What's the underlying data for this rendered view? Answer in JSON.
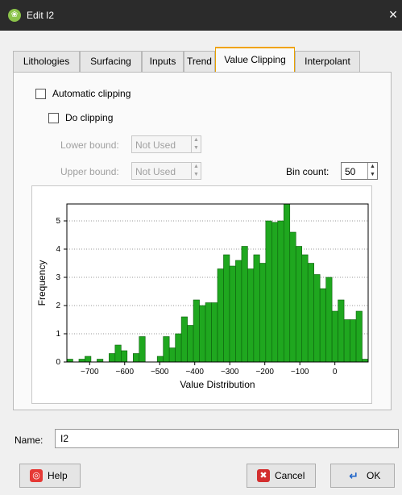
{
  "window": {
    "title": "Edit I2",
    "close_glyph": "×",
    "app_icon": "app-logo-icon"
  },
  "tabs": [
    {
      "label": "Lithologies",
      "active": false
    },
    {
      "label": "Surfacing",
      "active": false
    },
    {
      "label": "Inputs",
      "active": false
    },
    {
      "label": "Trend",
      "active": false
    },
    {
      "label": "Value Clipping",
      "active": true
    },
    {
      "label": "Interpolant",
      "active": false
    }
  ],
  "clipping": {
    "automatic_label": "Automatic clipping",
    "automatic_checked": false,
    "do_clipping_label": "Do clipping",
    "do_clipping_checked": false,
    "lower_bound_label": "Lower bound:",
    "lower_bound_value": "Not Used",
    "upper_bound_label": "Upper bound:",
    "upper_bound_value": "Not Used",
    "bin_count_label": "Bin count:",
    "bin_count_value": "50"
  },
  "chart_data": {
    "type": "bar",
    "xlabel": "Value Distribution",
    "ylabel": "Frequency",
    "xlim": [
      -765,
      95
    ],
    "ylim": [
      0,
      5.6
    ],
    "xticks": [
      -700,
      -600,
      -500,
      -400,
      -300,
      -200,
      -100,
      0
    ],
    "xtick_labels": [
      "−700",
      "−600",
      "−500",
      "−400",
      "−300",
      "−200",
      "−100",
      "0"
    ],
    "yticks": [
      0,
      1,
      2,
      3,
      4,
      5
    ],
    "ytick_labels": [
      "0",
      "1",
      "2",
      "3",
      "4",
      "5"
    ],
    "grid": "horizontal dotted",
    "bar_color": "#1fa71f",
    "bin_width": 17.2,
    "bin_starts": [
      -765,
      -747.8,
      -730.6,
      -713.4,
      -696.2,
      -679,
      -661.8,
      -644.6,
      -627.4,
      -610.2,
      -593,
      -575.8,
      -558.6,
      -541.4,
      -524.2,
      -507,
      -489.8,
      -472.6,
      -455.4,
      -438.2,
      -421,
      -403.8,
      -386.6,
      -369.4,
      -352.2,
      -335,
      -317.8,
      -300.6,
      -283.4,
      -266.2,
      -249,
      -231.8,
      -214.6,
      -197.4,
      -180.2,
      -163,
      -145.8,
      -128.6,
      -111.4,
      -94.2,
      -77,
      -59.8,
      -42.6,
      -25.4,
      -8.2,
      9,
      26.2,
      43.4,
      60.6,
      77.8
    ],
    "values": [
      0.1,
      0,
      0.1,
      0.2,
      0,
      0.1,
      0,
      0.3,
      0.6,
      0.4,
      0,
      0.3,
      0.9,
      0,
      0,
      0.2,
      0.9,
      0.5,
      1.0,
      1.6,
      1.3,
      2.2,
      2.0,
      2.1,
      2.1,
      3.3,
      3.8,
      3.4,
      3.6,
      4.1,
      3.3,
      3.8,
      3.5,
      5.0,
      4.95,
      5.0,
      5.6,
      4.6,
      4.1,
      3.8,
      3.5,
      3.1,
      2.6,
      3.0,
      1.8,
      2.2,
      1.5,
      1.5,
      1.8,
      0.1
    ]
  },
  "name_field": {
    "label": "Name:",
    "value": "I2"
  },
  "buttons": {
    "help": {
      "label": "Help",
      "icon": "lifebuoy-icon"
    },
    "cancel": {
      "label": "Cancel",
      "icon": "red-x-icon"
    },
    "ok": {
      "label": "OK",
      "icon": "enter-arrow-icon"
    }
  }
}
